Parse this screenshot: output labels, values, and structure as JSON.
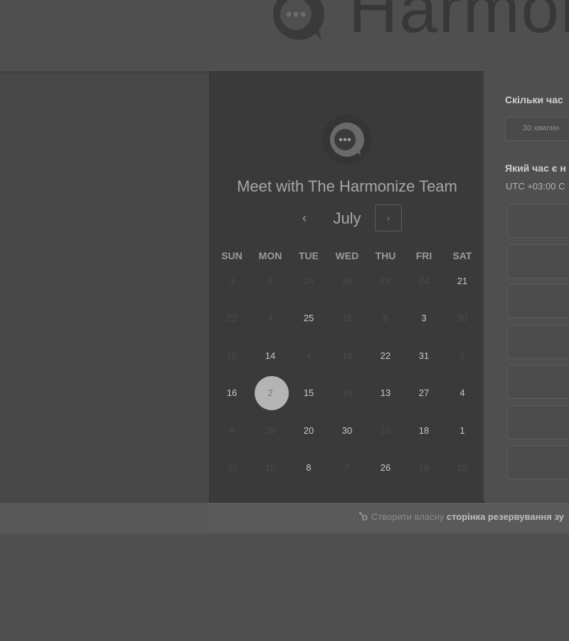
{
  "brand": {
    "name": "Harmonize"
  },
  "calendar": {
    "title": "Meet with The Harmonize Team",
    "month": "July",
    "prev_icon": "‹",
    "next_icon": "›",
    "weekdays": [
      "SUN",
      "MON",
      "TUE",
      "WED",
      "THU",
      "FRI",
      "SAT"
    ],
    "rows": [
      [
        {
          "d": "3",
          "on": false
        },
        {
          "d": "5",
          "on": false
        },
        {
          "d": "24",
          "on": false
        },
        {
          "d": "29",
          "on": false
        },
        {
          "d": "28",
          "on": false
        },
        {
          "d": "24",
          "on": false
        },
        {
          "d": "21",
          "on": true
        }
      ],
      [
        {
          "d": "22",
          "on": false
        },
        {
          "d": "4",
          "on": false
        },
        {
          "d": "25",
          "on": true
        },
        {
          "d": "16",
          "on": false
        },
        {
          "d": "8",
          "on": false
        },
        {
          "d": "3",
          "on": true
        },
        {
          "d": "30",
          "on": false
        }
      ],
      [
        {
          "d": "25",
          "on": false
        },
        {
          "d": "14",
          "on": true
        },
        {
          "d": "4",
          "on": false
        },
        {
          "d": "18",
          "on": false
        },
        {
          "d": "22",
          "on": true
        },
        {
          "d": "31",
          "on": true
        },
        {
          "d": "6",
          "on": false
        }
      ],
      [
        {
          "d": "16",
          "on": true
        },
        {
          "d": "2",
          "on": true,
          "selected": true
        },
        {
          "d": "15",
          "on": true
        },
        {
          "d": "19",
          "on": false
        },
        {
          "d": "13",
          "on": true
        },
        {
          "d": "27",
          "on": true
        },
        {
          "d": "4",
          "on": true
        }
      ],
      [
        {
          "d": "9",
          "on": false
        },
        {
          "d": "28",
          "on": false
        },
        {
          "d": "20",
          "on": true
        },
        {
          "d": "30",
          "on": true
        },
        {
          "d": "28",
          "on": false
        },
        {
          "d": "18",
          "on": true
        },
        {
          "d": "1",
          "on": true
        }
      ],
      [
        {
          "d": "30",
          "on": false
        },
        {
          "d": "15",
          "on": false
        },
        {
          "d": "8",
          "on": true
        },
        {
          "d": "7",
          "on": false
        },
        {
          "d": "26",
          "on": true
        },
        {
          "d": "16",
          "on": false
        },
        {
          "d": "29",
          "on": false
        }
      ]
    ]
  },
  "booking": {
    "duration_question": "Скільки час",
    "duration_option": "30 хвилин",
    "time_question": "Який час є н",
    "timezone": "UTC +03:00 С",
    "slot_count": 7
  },
  "footer": {
    "text": "Створити власну ",
    "link": "сторінка резервування зу"
  },
  "colors": {
    "overlay": "#4f4f4f",
    "panel": "#3a3a3a",
    "selected_day": "#b4b4b4"
  }
}
